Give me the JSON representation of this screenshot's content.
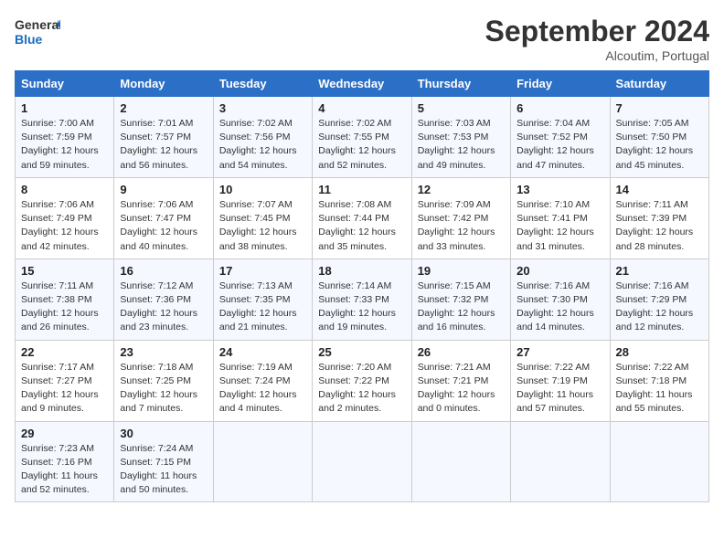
{
  "header": {
    "logo_general": "General",
    "logo_blue": "Blue",
    "month": "September 2024",
    "location": "Alcoutim, Portugal"
  },
  "weekdays": [
    "Sunday",
    "Monday",
    "Tuesday",
    "Wednesday",
    "Thursday",
    "Friday",
    "Saturday"
  ],
  "weeks": [
    [
      {
        "day": "1",
        "info": "Sunrise: 7:00 AM\nSunset: 7:59 PM\nDaylight: 12 hours\nand 59 minutes."
      },
      {
        "day": "2",
        "info": "Sunrise: 7:01 AM\nSunset: 7:57 PM\nDaylight: 12 hours\nand 56 minutes."
      },
      {
        "day": "3",
        "info": "Sunrise: 7:02 AM\nSunset: 7:56 PM\nDaylight: 12 hours\nand 54 minutes."
      },
      {
        "day": "4",
        "info": "Sunrise: 7:02 AM\nSunset: 7:55 PM\nDaylight: 12 hours\nand 52 minutes."
      },
      {
        "day": "5",
        "info": "Sunrise: 7:03 AM\nSunset: 7:53 PM\nDaylight: 12 hours\nand 49 minutes."
      },
      {
        "day": "6",
        "info": "Sunrise: 7:04 AM\nSunset: 7:52 PM\nDaylight: 12 hours\nand 47 minutes."
      },
      {
        "day": "7",
        "info": "Sunrise: 7:05 AM\nSunset: 7:50 PM\nDaylight: 12 hours\nand 45 minutes."
      }
    ],
    [
      {
        "day": "8",
        "info": "Sunrise: 7:06 AM\nSunset: 7:49 PM\nDaylight: 12 hours\nand 42 minutes."
      },
      {
        "day": "9",
        "info": "Sunrise: 7:06 AM\nSunset: 7:47 PM\nDaylight: 12 hours\nand 40 minutes."
      },
      {
        "day": "10",
        "info": "Sunrise: 7:07 AM\nSunset: 7:45 PM\nDaylight: 12 hours\nand 38 minutes."
      },
      {
        "day": "11",
        "info": "Sunrise: 7:08 AM\nSunset: 7:44 PM\nDaylight: 12 hours\nand 35 minutes."
      },
      {
        "day": "12",
        "info": "Sunrise: 7:09 AM\nSunset: 7:42 PM\nDaylight: 12 hours\nand 33 minutes."
      },
      {
        "day": "13",
        "info": "Sunrise: 7:10 AM\nSunset: 7:41 PM\nDaylight: 12 hours\nand 31 minutes."
      },
      {
        "day": "14",
        "info": "Sunrise: 7:11 AM\nSunset: 7:39 PM\nDaylight: 12 hours\nand 28 minutes."
      }
    ],
    [
      {
        "day": "15",
        "info": "Sunrise: 7:11 AM\nSunset: 7:38 PM\nDaylight: 12 hours\nand 26 minutes."
      },
      {
        "day": "16",
        "info": "Sunrise: 7:12 AM\nSunset: 7:36 PM\nDaylight: 12 hours\nand 23 minutes."
      },
      {
        "day": "17",
        "info": "Sunrise: 7:13 AM\nSunset: 7:35 PM\nDaylight: 12 hours\nand 21 minutes."
      },
      {
        "day": "18",
        "info": "Sunrise: 7:14 AM\nSunset: 7:33 PM\nDaylight: 12 hours\nand 19 minutes."
      },
      {
        "day": "19",
        "info": "Sunrise: 7:15 AM\nSunset: 7:32 PM\nDaylight: 12 hours\nand 16 minutes."
      },
      {
        "day": "20",
        "info": "Sunrise: 7:16 AM\nSunset: 7:30 PM\nDaylight: 12 hours\nand 14 minutes."
      },
      {
        "day": "21",
        "info": "Sunrise: 7:16 AM\nSunset: 7:29 PM\nDaylight: 12 hours\nand 12 minutes."
      }
    ],
    [
      {
        "day": "22",
        "info": "Sunrise: 7:17 AM\nSunset: 7:27 PM\nDaylight: 12 hours\nand 9 minutes."
      },
      {
        "day": "23",
        "info": "Sunrise: 7:18 AM\nSunset: 7:25 PM\nDaylight: 12 hours\nand 7 minutes."
      },
      {
        "day": "24",
        "info": "Sunrise: 7:19 AM\nSunset: 7:24 PM\nDaylight: 12 hours\nand 4 minutes."
      },
      {
        "day": "25",
        "info": "Sunrise: 7:20 AM\nSunset: 7:22 PM\nDaylight: 12 hours\nand 2 minutes."
      },
      {
        "day": "26",
        "info": "Sunrise: 7:21 AM\nSunset: 7:21 PM\nDaylight: 12 hours\nand 0 minutes."
      },
      {
        "day": "27",
        "info": "Sunrise: 7:22 AM\nSunset: 7:19 PM\nDaylight: 11 hours\nand 57 minutes."
      },
      {
        "day": "28",
        "info": "Sunrise: 7:22 AM\nSunset: 7:18 PM\nDaylight: 11 hours\nand 55 minutes."
      }
    ],
    [
      {
        "day": "29",
        "info": "Sunrise: 7:23 AM\nSunset: 7:16 PM\nDaylight: 11 hours\nand 52 minutes."
      },
      {
        "day": "30",
        "info": "Sunrise: 7:24 AM\nSunset: 7:15 PM\nDaylight: 11 hours\nand 50 minutes."
      },
      {
        "day": "",
        "info": ""
      },
      {
        "day": "",
        "info": ""
      },
      {
        "day": "",
        "info": ""
      },
      {
        "day": "",
        "info": ""
      },
      {
        "day": "",
        "info": ""
      }
    ]
  ]
}
